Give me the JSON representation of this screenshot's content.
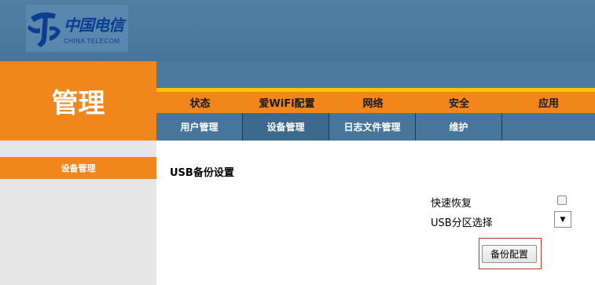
{
  "header": {
    "logo_text_cn": "中国电信",
    "logo_text_en": "CHINA TELECOM"
  },
  "title_block": {
    "title": "管理"
  },
  "nav": {
    "main_tabs": [
      {
        "label": "状态"
      },
      {
        "label": "爱WiFi配置"
      },
      {
        "label": "网络"
      },
      {
        "label": "安全"
      },
      {
        "label": "应用"
      }
    ],
    "sub_tabs": [
      {
        "label": "用户管理"
      },
      {
        "label": "设备管理"
      },
      {
        "label": "日志文件管理"
      },
      {
        "label": "维护"
      }
    ]
  },
  "sidebar": {
    "items": [
      {
        "label": "设备管理"
      }
    ]
  },
  "main": {
    "section_title": "USB备份设置",
    "quick_restore_label": "快速恢复",
    "quick_restore_checked": false,
    "usb_partition_label": "USB分区选择",
    "usb_partition_value": "",
    "backup_button_label": "备份配置"
  },
  "colors": {
    "banner": "#4f7fa5",
    "orange": "#f0861c",
    "yellow_line": "#f9c400",
    "subnav": "#46769c",
    "sidebar_bg": "#e6e6e6",
    "highlight_border": "#c0392b",
    "logo_blue": "#0b3d91"
  }
}
